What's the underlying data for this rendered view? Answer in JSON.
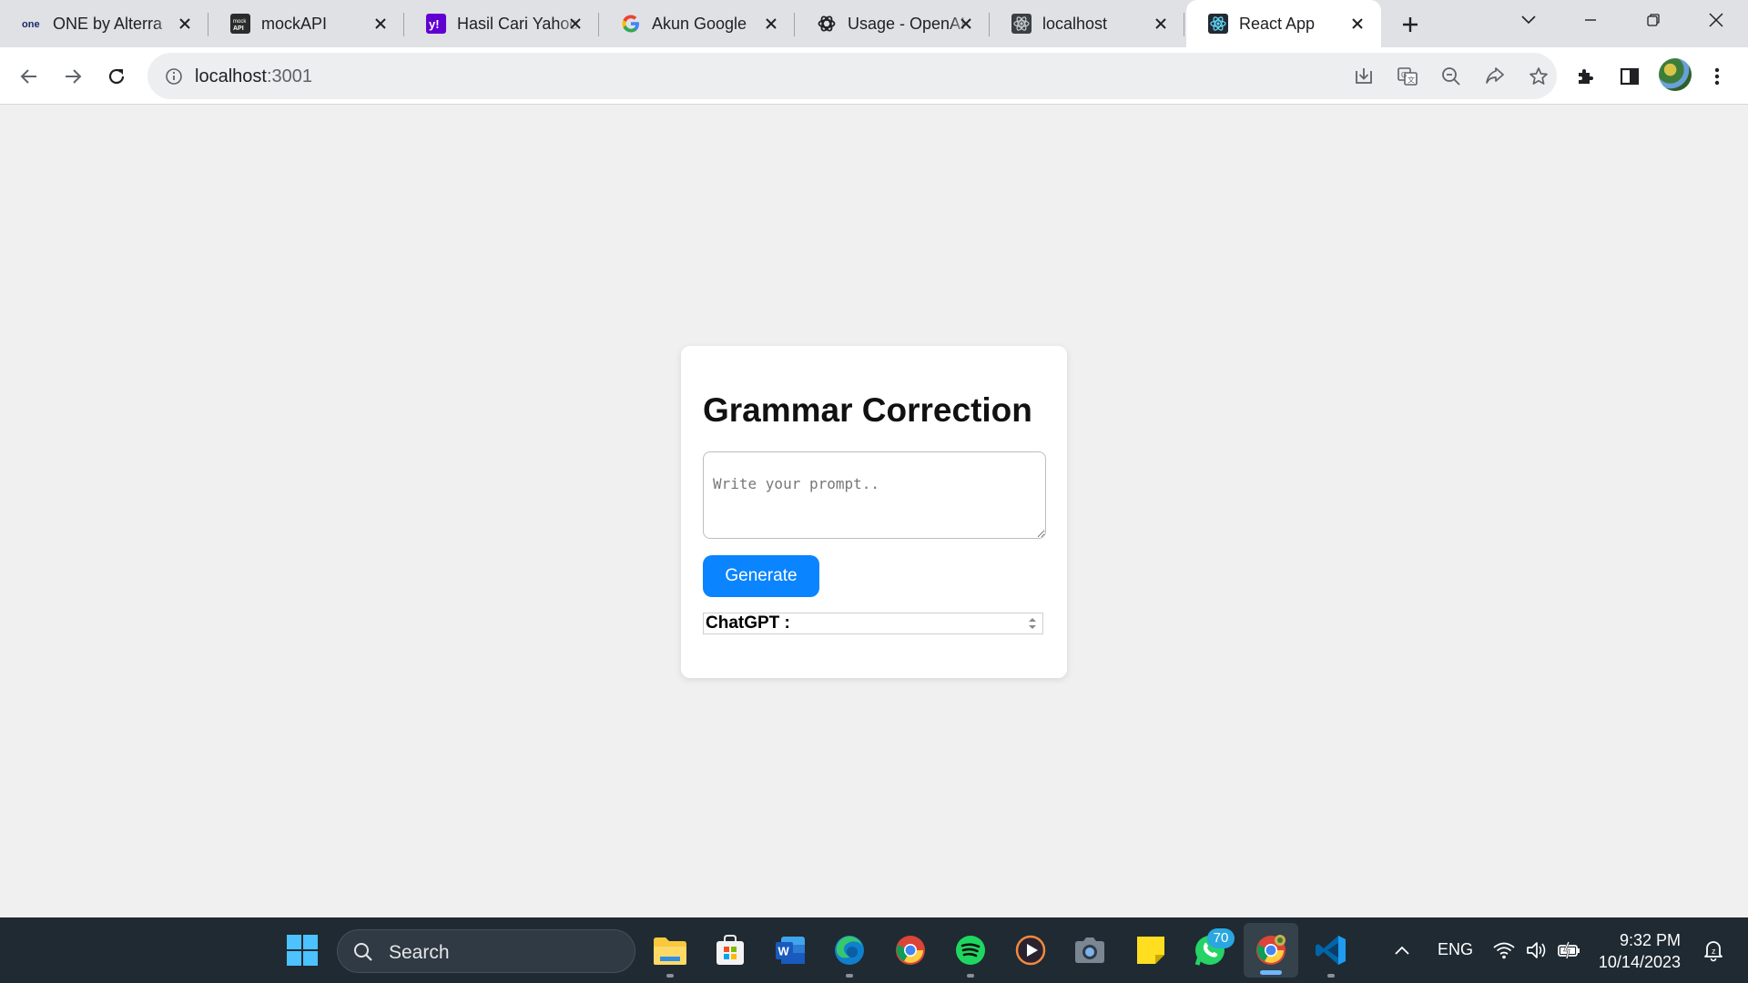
{
  "browser": {
    "tabs": [
      {
        "title": "ONE by Alterra",
        "icon": "one-logo-icon",
        "active": false
      },
      {
        "title": "mockAPI",
        "icon": "mockapi-icon",
        "active": false
      },
      {
        "title": "Hasil Cari Yahoo",
        "icon": "yahoo-icon",
        "active": false
      },
      {
        "title": "Akun Google",
        "icon": "google-icon",
        "active": false
      },
      {
        "title": "Usage - OpenAI",
        "icon": "openai-icon",
        "active": false
      },
      {
        "title": "localhost",
        "icon": "react-icon",
        "active": false
      },
      {
        "title": "React App",
        "icon": "react-icon",
        "active": true
      }
    ],
    "address": {
      "host": "localhost",
      "port": ":3001"
    }
  },
  "app": {
    "title": "Grammar Correction",
    "prompt_placeholder": "Write your prompt..",
    "generate_label": "Generate",
    "result_label": "ChatGPT :",
    "accent_color": "#0a84ff"
  },
  "taskbar": {
    "search_label": "Search",
    "language": "ENG",
    "time": "9:32 PM",
    "date": "10/14/2023",
    "whatsapp_badge": "70",
    "apps": [
      "windows-start-icon",
      "file-explorer-icon",
      "microsoft-store-icon",
      "word-icon",
      "edge-icon",
      "chrome-icon",
      "spotify-icon",
      "media-player-icon",
      "camera-icon",
      "sticky-notes-icon",
      "whatsapp-icon",
      "chrome-canary-icon",
      "vscode-icon"
    ]
  }
}
